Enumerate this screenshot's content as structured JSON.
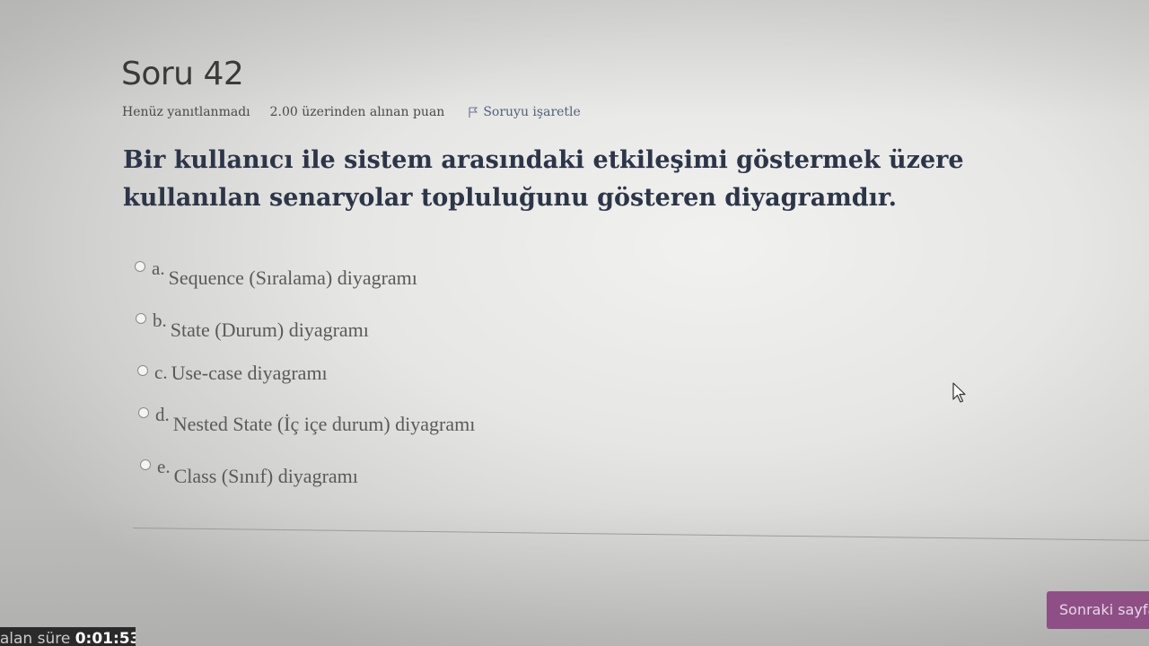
{
  "question": {
    "title": "Soru 42",
    "status": "Henüz yanıtlanmadı",
    "points": "2.00 üzerinden alınan puan",
    "flag_label": "Soruyu işaretle",
    "text": "Bir kullanıcı ile sistem arasındaki etkileşimi göstermek üzere kullanılan senaryolar topluluğunu gösteren diyagramdır."
  },
  "answers": [
    {
      "letter": "a.",
      "text": "Sequence (Sıralama) diyagramı"
    },
    {
      "letter": "b.",
      "text": "State (Durum) diyagramı"
    },
    {
      "letter": "c.",
      "text": "Use-case diyagramı"
    },
    {
      "letter": "d.",
      "text": "Nested State (İç içe durum) diyagramı"
    },
    {
      "letter": "e.",
      "text": "Class (Sınıf) diyagramı"
    }
  ],
  "navigation": {
    "next_label": "Sonraki sayfa"
  },
  "timer": {
    "label": "Kalan süre",
    "value": "0:01:53"
  },
  "icons": {
    "flag": "flag-icon",
    "radio": "radio-unchecked-icon",
    "cursor": "mouse-pointer-icon"
  },
  "colors": {
    "question_text": "#2c3648",
    "next_button": "#8e4f86",
    "timer_bg": "#2a2a2a"
  }
}
